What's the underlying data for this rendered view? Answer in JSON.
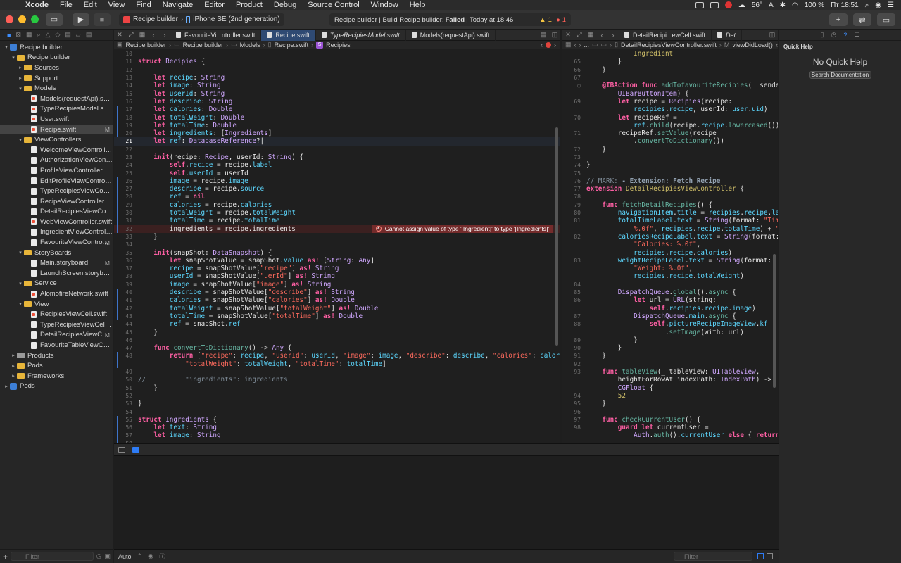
{
  "menubar": {
    "app": "Xcode",
    "items": [
      "File",
      "Edit",
      "View",
      "Find",
      "Navigate",
      "Editor",
      "Product",
      "Debug",
      "Source Control",
      "Window",
      "Help"
    ],
    "status": {
      "temperature": "56°",
      "keyboard": "A",
      "battery": "100 %",
      "clock": "Пт 18:51"
    }
  },
  "toolbar": {
    "scheme": "Recipe builder",
    "device": "iPhone SE (2nd generation)",
    "activity_prefix": "Recipe builder | Build Recipe builder:",
    "activity_status": "Failed",
    "activity_time": "| Today at 18:46",
    "warnings": "1",
    "errors": "1"
  },
  "navigator": {
    "items": [
      {
        "label": "Recipe builder",
        "indent": 0,
        "kind": "project",
        "disc": "▾"
      },
      {
        "label": "Recipe builder",
        "indent": 1,
        "kind": "folder",
        "disc": "▾"
      },
      {
        "label": "Sources",
        "indent": 2,
        "kind": "folder",
        "disc": "▸"
      },
      {
        "label": "Support",
        "indent": 2,
        "kind": "folder",
        "disc": "▸"
      },
      {
        "label": "Models",
        "indent": 2,
        "kind": "folder",
        "disc": "▾"
      },
      {
        "label": "Models(requestApi).swift",
        "indent": 3,
        "kind": "file"
      },
      {
        "label": "TypeRecipiesModel.swift",
        "indent": 3,
        "kind": "file"
      },
      {
        "label": "User.swift",
        "indent": 3,
        "kind": "file"
      },
      {
        "label": "Recipe.swift",
        "indent": 3,
        "kind": "file",
        "status": "M",
        "selected": true
      },
      {
        "label": "ViewControllers",
        "indent": 2,
        "kind": "folder",
        "disc": "▾"
      },
      {
        "label": "WelcomeViewController...",
        "indent": 3,
        "kind": "file"
      },
      {
        "label": "AuthorizationViewContr...",
        "indent": 3,
        "kind": "file"
      },
      {
        "label": "ProfileViewController.s...",
        "indent": 3,
        "kind": "file"
      },
      {
        "label": "EditProfileViewControll...",
        "indent": 3,
        "kind": "file"
      },
      {
        "label": "TypeRecipiesViewContr...",
        "indent": 3,
        "kind": "file"
      },
      {
        "label": "RecipeViewController.s...",
        "indent": 3,
        "kind": "file"
      },
      {
        "label": "DetailRecipiesViewCont...",
        "indent": 3,
        "kind": "file"
      },
      {
        "label": "WebViewController.swift",
        "indent": 3,
        "kind": "file"
      },
      {
        "label": "IngredientViewControll...",
        "indent": 3,
        "kind": "file"
      },
      {
        "label": "FavouriteViewContro...",
        "indent": 3,
        "kind": "file",
        "status": "M"
      },
      {
        "label": "StoryBoards",
        "indent": 2,
        "kind": "folder",
        "disc": "▾"
      },
      {
        "label": "Main.storyboard",
        "indent": 3,
        "kind": "file",
        "status": "M"
      },
      {
        "label": "LaunchScreen.storyboa...",
        "indent": 3,
        "kind": "file"
      },
      {
        "label": "Service",
        "indent": 2,
        "kind": "folder",
        "disc": "▾"
      },
      {
        "label": "AlomofireNetwork.swift",
        "indent": 3,
        "kind": "file"
      },
      {
        "label": "View",
        "indent": 2,
        "kind": "folder",
        "disc": "▾"
      },
      {
        "label": "RecipiesViewCell.swift",
        "indent": 3,
        "kind": "file"
      },
      {
        "label": "TypeRecipiesViewCell.s...",
        "indent": 3,
        "kind": "file"
      },
      {
        "label": "DetailRecipiesViewC...",
        "indent": 3,
        "kind": "file",
        "status": "M"
      },
      {
        "label": "FavouriteTableViewCell....",
        "indent": 3,
        "kind": "file"
      },
      {
        "label": "Products",
        "indent": 1,
        "kind": "folder-gray",
        "disc": "▸"
      },
      {
        "label": "Pods",
        "indent": 1,
        "kind": "folder",
        "disc": "▸"
      },
      {
        "label": "Frameworks",
        "indent": 1,
        "kind": "folder",
        "disc": "▸"
      },
      {
        "label": "Pods",
        "indent": 0,
        "kind": "project",
        "disc": "▸"
      }
    ],
    "filter_placeholder": "Filter"
  },
  "left_editor": {
    "tabs": [
      {
        "label": "FavouriteVi...ntroller.swift",
        "active": false,
        "italic": false
      },
      {
        "label": "Recipe.swift",
        "active": true,
        "italic": false
      },
      {
        "label": "TypeRecipiesModel.swift",
        "active": false,
        "italic": true
      },
      {
        "label": "Models(requestApi).swift",
        "active": false,
        "italic": false
      }
    ],
    "breadcrumb": [
      "Recipe builder",
      "Recipe builder",
      "Models",
      "Recipe.swift",
      "Recipies"
    ],
    "error_message": "Cannot assign value of type '[Ingredient]' to type '[Ingredients]'"
  },
  "right_editor": {
    "tabs": [
      {
        "label": "DetailRecipi...ewCell.swift",
        "active": false,
        "italic": false
      },
      {
        "label": "Det",
        "active": false,
        "italic": true
      }
    ],
    "breadcrumb": [
      "...",
      "DetailRecipiesViewController.swift",
      "viewDidLoad()"
    ]
  },
  "debug": {
    "mode": "Auto",
    "filter_placeholder": "Filter"
  },
  "inspector": {
    "title": "Quick Help",
    "empty": "No Quick Help",
    "search_button": "Search Documentation"
  }
}
